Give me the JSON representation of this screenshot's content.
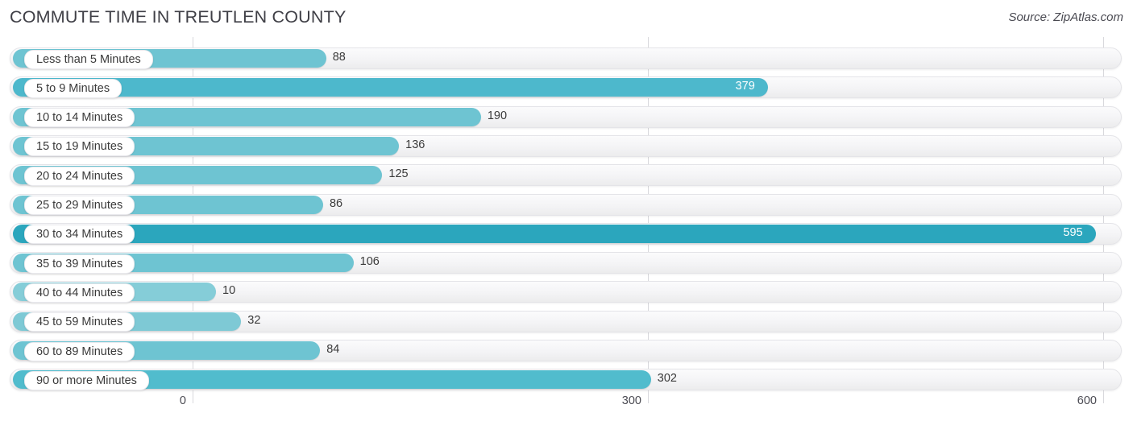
{
  "header": {
    "title": "COMMUTE TIME IN TREUTLEN COUNTY",
    "source": "Source: ZipAtlas.com"
  },
  "colors": {
    "bar_light": "#85cdd8",
    "bar_mid": "#6ec4d2",
    "bar_strong": "#4db8cc",
    "bar_dark": "#2ba6bd",
    "track_bg": "#f4f4f6",
    "gridline": "#d8d8dc",
    "text": "#3a3a3a",
    "value_inside": "#ffffff"
  },
  "chart_data": {
    "type": "bar",
    "orientation": "horizontal",
    "title": "COMMUTE TIME IN TREUTLEN COUNTY",
    "xlabel": "",
    "ylabel": "",
    "xlim": [
      0,
      600
    ],
    "ticks": [
      "0",
      "300",
      "600"
    ],
    "tick_values": [
      0,
      300,
      600
    ],
    "grid": true,
    "legend": "none",
    "categories": [
      "Less than 5 Minutes",
      "5 to 9 Minutes",
      "10 to 14 Minutes",
      "15 to 19 Minutes",
      "20 to 24 Minutes",
      "25 to 29 Minutes",
      "30 to 34 Minutes",
      "35 to 39 Minutes",
      "40 to 44 Minutes",
      "45 to 59 Minutes",
      "60 to 89 Minutes",
      "90 or more Minutes"
    ],
    "values": [
      88,
      379,
      190,
      136,
      125,
      86,
      595,
      106,
      10,
      32,
      84,
      302
    ],
    "value_labels": [
      "88",
      "379",
      "190",
      "136",
      "125",
      "86",
      "595",
      "106",
      "10",
      "32",
      "84",
      "302"
    ]
  },
  "rows": [
    {
      "label": "Less than 5 Minutes",
      "value": 88,
      "value_label": "88",
      "inside": false,
      "color": "#6ec4d2"
    },
    {
      "label": "5 to 9 Minutes",
      "value": 379,
      "value_label": "379",
      "inside": true,
      "color": "#4db8cc"
    },
    {
      "label": "10 to 14 Minutes",
      "value": 190,
      "value_label": "190",
      "inside": false,
      "color": "#6ec4d2"
    },
    {
      "label": "15 to 19 Minutes",
      "value": 136,
      "value_label": "136",
      "inside": false,
      "color": "#6ec4d2"
    },
    {
      "label": "20 to 24 Minutes",
      "value": 125,
      "value_label": "125",
      "inside": false,
      "color": "#6ec4d2"
    },
    {
      "label": "25 to 29 Minutes",
      "value": 86,
      "value_label": "86",
      "inside": false,
      "color": "#6ec4d2"
    },
    {
      "label": "30 to 34 Minutes",
      "value": 595,
      "value_label": "595",
      "inside": true,
      "color": "#2ba6bd"
    },
    {
      "label": "35 to 39 Minutes",
      "value": 106,
      "value_label": "106",
      "inside": false,
      "color": "#6ec4d2"
    },
    {
      "label": "40 to 44 Minutes",
      "value": 10,
      "value_label": "10",
      "inside": false,
      "color": "#85cdd8"
    },
    {
      "label": "45 to 59 Minutes",
      "value": 32,
      "value_label": "32",
      "inside": false,
      "color": "#7ec9d5"
    },
    {
      "label": "60 to 89 Minutes",
      "value": 84,
      "value_label": "84",
      "inside": false,
      "color": "#6ec4d2"
    },
    {
      "label": "90 or more Minutes",
      "value": 302,
      "value_label": "302",
      "inside": false,
      "color": "#51bccd"
    }
  ],
  "axis": {
    "ticks": [
      {
        "label": "0",
        "value": 0
      },
      {
        "label": "300",
        "value": 300
      },
      {
        "label": "600",
        "value": 600
      }
    ]
  }
}
